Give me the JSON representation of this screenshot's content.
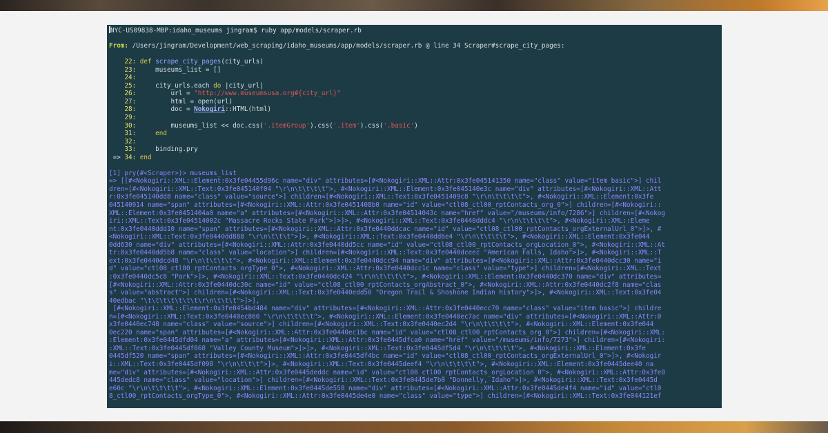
{
  "terminal": {
    "prompt": "NYC-US09838-MBP:idaho_museums jingram$ ruby app/models/scraper.rb",
    "from_label": "From:",
    "from_text": " /Users/jingram/Development/web_scraping/idaho_museums/app/models/scraper.rb @ line 34 Scraper#scrape_city_pages:",
    "code_lines": [
      {
        "marker": "    ",
        "num": "22:",
        "segments": [
          {
            "cls": "kw",
            "t": " def "
          },
          {
            "cls": "fn",
            "t": "scrape_city_pages"
          },
          {
            "cls": "plain",
            "t": "(city_urls)"
          }
        ]
      },
      {
        "marker": "    ",
        "num": "23:",
        "segments": [
          {
            "cls": "plain",
            "t": "     museums_list = []"
          }
        ]
      },
      {
        "marker": "    ",
        "num": "24:",
        "segments": [
          {
            "cls": "plain",
            "t": ""
          }
        ]
      },
      {
        "marker": "    ",
        "num": "25:",
        "segments": [
          {
            "cls": "plain",
            "t": "     city_urls.each "
          },
          {
            "cls": "kw",
            "t": "do"
          },
          {
            "cls": "plain",
            "t": " |city_url|"
          }
        ]
      },
      {
        "marker": "    ",
        "num": "26:",
        "segments": [
          {
            "cls": "plain",
            "t": "         url = "
          },
          {
            "cls": "str",
            "t": "\"http://www.museumsusa.org#{city_url}\""
          }
        ]
      },
      {
        "marker": "    ",
        "num": "27:",
        "segments": [
          {
            "cls": "plain",
            "t": "         html = open(url)"
          }
        ]
      },
      {
        "marker": "    ",
        "num": "28:",
        "segments": [
          {
            "cls": "plain",
            "t": "         doc = "
          },
          {
            "cls": "const",
            "t": "Nokogiri"
          },
          {
            "cls": "plain",
            "t": "::HTML(html)"
          }
        ]
      },
      {
        "marker": "    ",
        "num": "29:",
        "segments": [
          {
            "cls": "plain",
            "t": ""
          }
        ]
      },
      {
        "marker": "    ",
        "num": "30:",
        "segments": [
          {
            "cls": "plain",
            "t": "         museums_list << doc.css("
          },
          {
            "cls": "str",
            "t": "'.itemGroup'"
          },
          {
            "cls": "plain",
            "t": ").css("
          },
          {
            "cls": "str",
            "t": "'.item'"
          },
          {
            "cls": "plain",
            "t": ").css("
          },
          {
            "cls": "str",
            "t": "'.basic'"
          },
          {
            "cls": "plain",
            "t": ")"
          }
        ]
      },
      {
        "marker": "    ",
        "num": "31:",
        "segments": [
          {
            "cls": "kw",
            "t": "     end"
          }
        ]
      },
      {
        "marker": "    ",
        "num": "32:",
        "segments": [
          {
            "cls": "plain",
            "t": ""
          }
        ]
      },
      {
        "marker": "    ",
        "num": "33:",
        "segments": [
          {
            "cls": "plain",
            "t": "     binding.pry"
          }
        ]
      },
      {
        "marker": " => ",
        "num": "34:",
        "segments": [
          {
            "cls": "kw",
            "t": " end"
          }
        ]
      }
    ],
    "pry_prompt": "[1] pry(#<Scraper>)> museums_list",
    "output_lines": [
      "=> [[#<Nokogiri::XML::Element:0x3fe04455d96c name=\"div\" attributes=[#<Nokogiri::XML::Attr:0x3fe045141350 name=\"class\" value=\"item basic\">] chil",
      "dren=[#<Nokogiri::XML::Text:0x3fe045140f04 \"\\r\\n\\t\\t\\t\\t\">, #<Nokogiri::XML::Element:0x3fe045140e3c name=\"div\" attributes=[#<Nokogiri::XML::Att",
      "r:0x3fe045140dd8 name=\"class\" value=\"source\">] children=[#<Nokogiri::XML::Text:0x3fe0451409c8 \"\\r\\n\\t\\t\\t\\t\">, #<Nokogiri::XML::Element:0x3fe",
      "045140914 name=\"span\" attributes=[#<Nokogiri::XML::Attr:0x3fe0451408b0 name=\"id\" value=\"ctl08_ctl00_rptContacts_org_0\">] children=[#<Nokogiri::",
      "XML::Element:0x3fe0451404a0 name=\"a\" attributes=[#<Nokogiri::XML::Attr:0x3fe04514043c name=\"href\" value=\"/museums/info/7286\">] children=[#<Nokog",
      "iri::XML::Text:0x3fe04514002c \"Massacre Rocks State Park\">]>]>, #<Nokogiri::XML::Text:0x3fe0440dddc4 \"\\r\\n\\t\\t\\t\\t\">, #<Nokogiri::XML::Eleme",
      "nt:0x3fe0440ddd10 name=\"span\" attributes=[#<Nokogiri::XML::Attr:0x3fe0440ddcac name=\"id\" value=\"ctl08_ctl00_rptContacts_orgExternalUrl_0\">]>, #",
      "<Nokogiri::XML::Text:0x3fe0440dd888 \"\\r\\n\\t\\t\\t\">]>, #<Nokogiri::XML::Text:0x3fe0440dd6e4 \"\\r\\n\\t\\t\\t\\t\">, #<Nokogiri::XML::Element:0x3fe044",
      "0dd630 name=\"div\" attributes=[#<Nokogiri::XML::Attr:0x3fe0440dd5cc name=\"id\" value=\"ctl08_ctl00_rptContacts_orgLocation_0\">, #<Nokogiri::XML::At",
      "tr:0x3fe0440dd5b8 name=\"class\" value=\"location\">] children=[#<Nokogiri::XML::Text:0x3fe0440dceec \"American Falls, Idaho\">]>, #<Nokogiri::XML::T",
      "ext:0x3fe0440dcd48 \"\\r\\n\\t\\t\\t\\t\">, #<Nokogiri::XML::Element:0x3fe0440dcc94 name=\"div\" attributes=[#<Nokogiri::XML::Attr:0x3fe0440dcc30 name=\"i",
      "d\" value=\"ctl08_ctl00_rptContacts_orgType_0\">, #<Nokogiri::XML::Attr:0x3fe0440dcc1c name=\"class\" value=\"type\">] children=[#<Nokogiri::XML::Text",
      ":0x3fe0440dc5c8 \"Park\">]>, #<Nokogiri::XML::Text:0x3fe0440dc424 \"\\r\\n\\t\\t\\t\\t\">, #<Nokogiri::XML::Element:0x3fe0440dc370 name=\"div\" attributes=",
      "[#<Nokogiri::XML::Attr:0x3fe0440dc30c name=\"id\" value=\"ctl08_ctl00_rptContacts_orgAbstract_0\">, #<Nokogiri::XML::Attr:0x3fe0440dc2f8 name=\"clas",
      "s\" value=\"abstract\">] children=[#<Nokogiri::XML::Text:0x3fe0440edd50 \"Oregon Trail & Shoshone Indian history\">]>, #<Nokogiri::XML::Text:0x3fe04",
      "40edbac \"\\t\\t\\t\\t\\t\\t\\t\\r\\n\\t\\t\\t\">]>],",
      " [#<Nokogiri::XML::Element:0x3fe0454bd484 name=\"div\" attributes=[#<Nokogiri::XML::Attr:0x3fe0440ecc70 name=\"class\" value=\"item basic\">] childre",
      "n=[#<Nokogiri::XML::Text:0x3fe0440ec860 \"\\r\\n\\t\\t\\t\\t\">, #<Nokogiri::XML::Element:0x3fe0440ec7ac name=\"div\" attributes=[#<Nokogiri::XML::Attr:0",
      "x3fe0440ec748 name=\"class\" value=\"source\">] children=[#<Nokogiri::XML::Text:0x3fe0440ec2d4 \"\\r\\n\\t\\t\\t\\t\">, #<Nokogiri::XML::Element:0x3fe044",
      "0ec220 name=\"span\" attributes=[#<Nokogiri::XML::Attr:0x3fe0440ec1bc name=\"id\" value=\"ctl08_ctl00_rptContacts_org_0\">] children=[#<Nokogiri::XML:",
      ":Element:0x3fe0445dfd04 name=\"a\" attributes=[#<Nokogiri::XML::Attr:0x3fe0445dfca0 name=\"href\" value=\"/museums/info/7273\">] children=[#<Nokogiri:",
      ":XML::Text:0x3fe0445df868 \"Valley County Museum\">]>]>, #<Nokogiri::XML::Text:0x3fe0445df5d4 \"\\r\\n\\t\\t\\t\\t\">, #<Nokogiri::XML::Element:0x3fe",
      "0445df520 name=\"span\" attributes=[#<Nokogiri::XML::Attr:0x3fe0445df4bc name=\"id\" value=\"ctl08_ctl00_rptContacts_orgExternalUrl_0\">]>, #<Nokogir",
      "i::XML::Text:0x3fe0445df098 \"\\r\\n\\t\\t\\t\">]>, #<Nokogiri::XML::Text:0x3fe0445deef4 \"\\r\\n\\t\\t\\t\\t\">, #<Nokogiri::XML::Element:0x3fe0445dee40 na",
      "me=\"div\" attributes=[#<Nokogiri::XML::Attr:0x3fe0445deddc name=\"id\" value=\"ctl08_ctl00_rptContacts_orgLocation_0\">, #<Nokogiri::XML::Attr:0x3fe0",
      "445dedc8 name=\"class\" value=\"location\">] children=[#<Nokogiri::XML::Text:0x3fe0445de7b0 \"Donnelly, Idaho\">]>, #<Nokogiri::XML::Text:0x3fe0445d",
      "e60c \"\\r\\n\\t\\t\\t\\t\">, #<Nokogiri::XML::Element:0x3fe0445de558 name=\"div\" attributes=[#<Nokogiri::XML::Attr:0x3fe0445de4f4 name=\"id\" value=\"ctl0",
      "8_ctl00_rptContacts_orgType_0\">, #<Nokogiri::XML::Attr:0x3fe0445de4e0 name=\"class\" value=\"type\">] children=[#<Nokogiri::XML::Text:0x3fe044121ef"
    ]
  }
}
